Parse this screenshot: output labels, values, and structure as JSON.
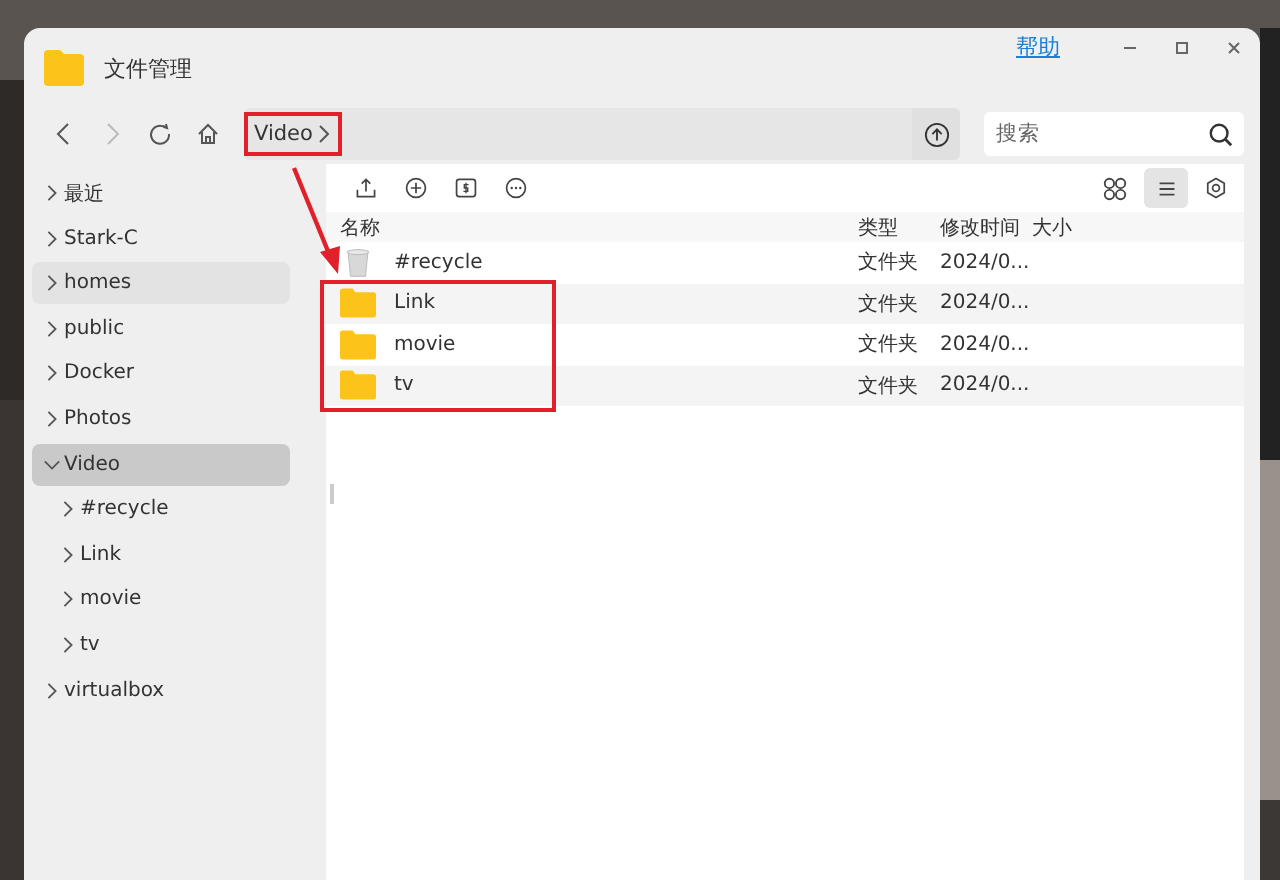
{
  "window": {
    "title": "文件管理",
    "help": "帮助"
  },
  "breadcrumb": {
    "segments": [
      {
        "label": "Video",
        "highlighted": true
      }
    ]
  },
  "search": {
    "placeholder": "搜索"
  },
  "sidebar": {
    "items": [
      {
        "label": "最近",
        "selected": false,
        "hovered": false,
        "expanded": false
      },
      {
        "label": "Stark-C",
        "selected": false,
        "hovered": false,
        "expanded": false
      },
      {
        "label": "homes",
        "selected": false,
        "hovered": true,
        "expanded": false
      },
      {
        "label": "public",
        "selected": false,
        "hovered": false,
        "expanded": false
      },
      {
        "label": "Docker",
        "selected": false,
        "hovered": false,
        "expanded": false
      },
      {
        "label": "Photos",
        "selected": false,
        "hovered": false,
        "expanded": false
      },
      {
        "label": "Video",
        "selected": true,
        "hovered": false,
        "expanded": true,
        "children": [
          {
            "label": "#recycle",
            "selected": false,
            "hovered": false,
            "expanded": false
          },
          {
            "label": "Link",
            "selected": false,
            "hovered": false,
            "expanded": false
          },
          {
            "label": "movie",
            "selected": false,
            "hovered": false,
            "expanded": false
          },
          {
            "label": "tv",
            "selected": false,
            "hovered": false,
            "expanded": false
          }
        ]
      },
      {
        "label": "virtualbox",
        "selected": false,
        "hovered": false,
        "expanded": false
      }
    ]
  },
  "view": {
    "buttons": [
      {
        "kind": "grid",
        "selected": false
      },
      {
        "kind": "list",
        "selected": true
      }
    ]
  },
  "table": {
    "columns": [
      "名称",
      "类型",
      "修改时间",
      "大小"
    ],
    "rows": [
      {
        "kind": "recycle",
        "name": "#recycle",
        "type": "文件夹",
        "modified": "2024/0...",
        "highlighted": false
      },
      {
        "kind": "folder",
        "name": "Link",
        "type": "文件夹",
        "modified": "2024/0...",
        "highlighted": true
      },
      {
        "kind": "folder",
        "name": "movie",
        "type": "文件夹",
        "modified": "2024/0...",
        "highlighted": true
      },
      {
        "kind": "folder",
        "name": "tv",
        "type": "文件夹",
        "modified": "2024/0...",
        "highlighted": true
      }
    ]
  }
}
